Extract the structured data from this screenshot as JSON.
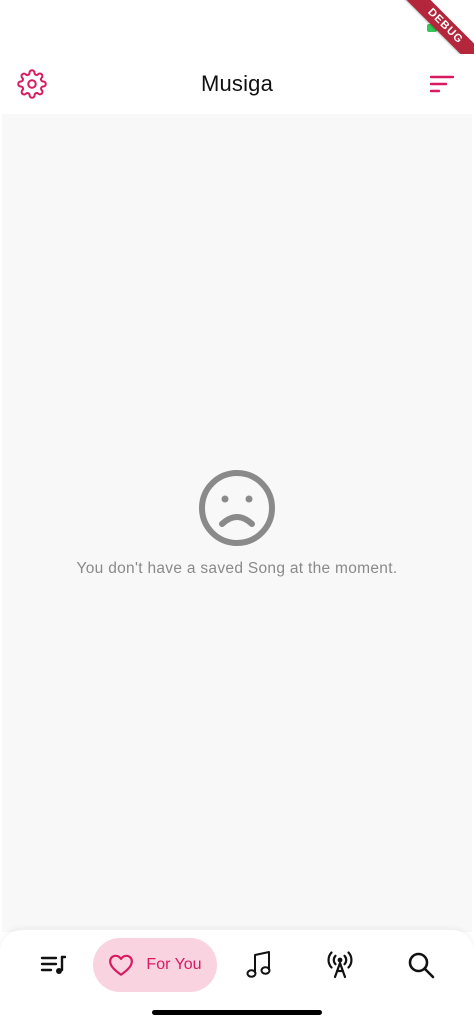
{
  "debug_banner": {
    "label": "DEBUG",
    "color": "#b3263b"
  },
  "header": {
    "title": "Musiga",
    "left_icon": "gear-icon",
    "right_icon": "sort-icon",
    "accent_color": "#d81b60"
  },
  "empty_state": {
    "icon": "sad-face-icon",
    "message": "You don't have a saved Song at the moment.",
    "icon_color": "#8a8a8a"
  },
  "bottom_nav": {
    "active_bg": "#f9d3e0",
    "items": [
      {
        "icon": "playlist-icon",
        "label": ""
      },
      {
        "icon": "heart-icon",
        "label": "For You",
        "active": true
      },
      {
        "icon": "music-note-icon",
        "label": ""
      },
      {
        "icon": "radio-tower-icon",
        "label": ""
      },
      {
        "icon": "search-icon",
        "label": ""
      }
    ]
  }
}
